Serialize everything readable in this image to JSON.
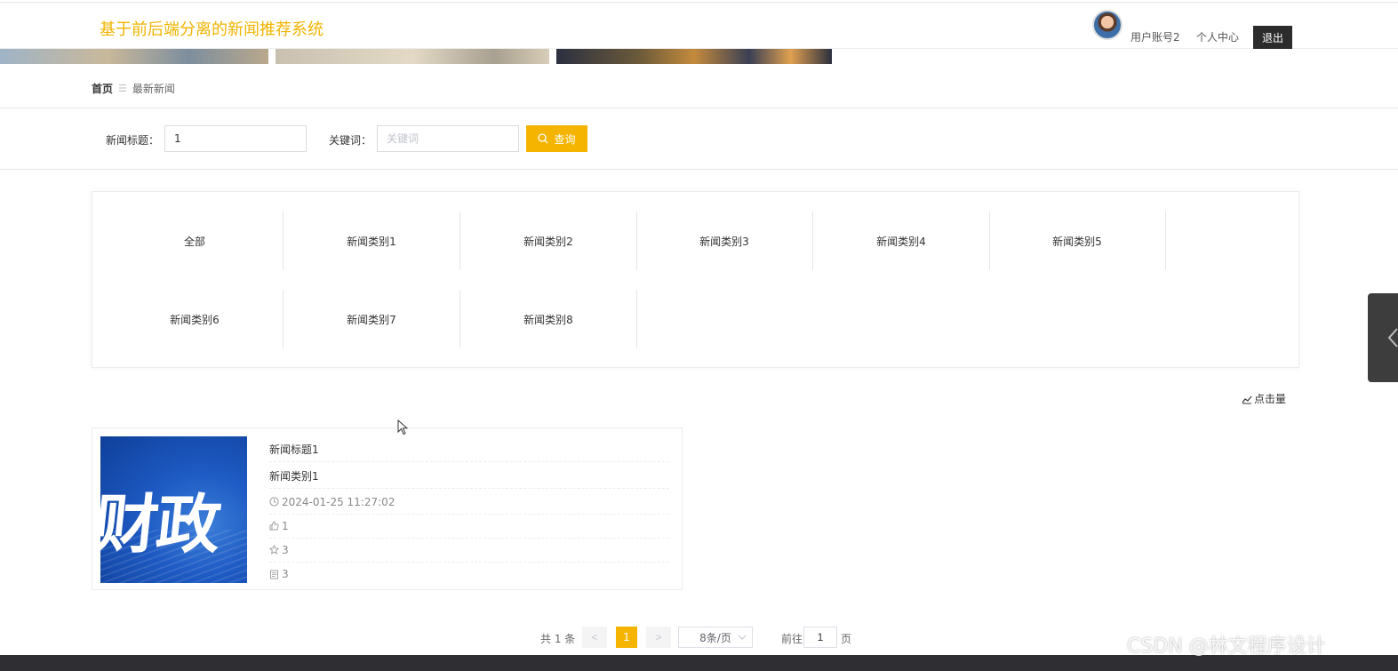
{
  "header": {
    "site_title": "基于前后端分离的新闻推荐系统",
    "user_account": "用户账号2",
    "user_center": "个人中心",
    "logout": "退出"
  },
  "breadcrumb": {
    "home": "首页",
    "separator": "☰",
    "current": "最新新闻"
  },
  "search": {
    "title_label": "新闻标题：",
    "title_value": "1",
    "keyword_label": "关键词：",
    "keyword_placeholder": "关键词",
    "query_button": "查询"
  },
  "categories": [
    "全部",
    "新闻类别1",
    "新闻类别2",
    "新闻类别3",
    "新闻类别4",
    "新闻类别5",
    "新闻类别6",
    "新闻类别7",
    "新闻类别8"
  ],
  "sort": {
    "label": "点击量"
  },
  "news": [
    {
      "thumbnail_text": "财政",
      "title": "新闻标题1",
      "category": "新闻类别1",
      "time": "2024-01-25 11:27:02",
      "likes": "1",
      "favorites": "3",
      "clicks": "3"
    }
  ],
  "pagination": {
    "total": "共 1 条",
    "prev": "<",
    "current_page": "1",
    "next": ">",
    "page_size": "8条/页",
    "goto_label": "前往",
    "goto_value": "1",
    "goto_unit": "页"
  },
  "watermark": "CSDN @林文程序设计",
  "colors": {
    "accent": "#f4b400",
    "title": "#f0b400",
    "dark": "#2b2b2b"
  }
}
